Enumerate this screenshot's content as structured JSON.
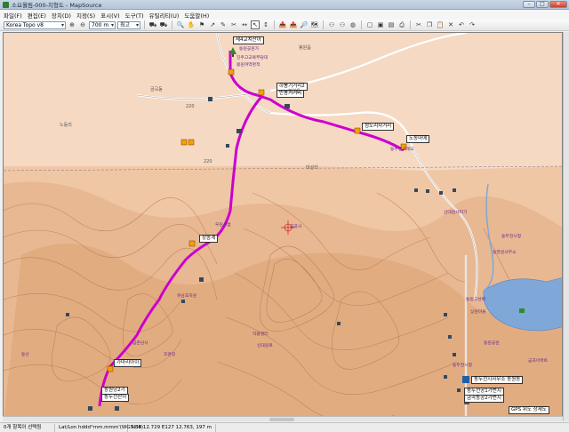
{
  "window": {
    "title": "소요월림-000-지형도 - MapSource",
    "buttons": {
      "minimize": "–",
      "maximize": "□",
      "close": "✕"
    }
  },
  "menu": [
    "파일(F)",
    "편집(E)",
    "장치(D)",
    "지정(S)",
    "표시(V)",
    "도구(T)",
    "유틸리티(U)",
    "도움말(H)"
  ],
  "toolbar": {
    "product": "Korea Topo v8",
    "zoom": "700 m",
    "detail": "최고"
  },
  "map": {
    "waypoints": [
      {
        "name": "제4교치산아"
      },
      {
        "name": "하봉기거리2"
      },
      {
        "name": "반봉기거리"
      },
      {
        "name": "청도리사거리"
      },
      {
        "name": "노동마에"
      },
      {
        "name": "상송계"
      },
      {
        "name": "가마리아이"
      },
      {
        "name": "동원당2가"
      },
      {
        "name": "동두천산아"
      },
      {
        "name": "동두천시청"
      },
      {
        "name": "동영원사무소"
      }
    ],
    "place_labels": [
      "봉원읍",
      "220",
      "220",
      "봉원읍",
      "노동리",
      "금곡동",
      "대성리"
    ],
    "pois": [
      "동원공원가",
      "진주고교북부당대",
      "봉원여역명적",
      "동두천교해모",
      "금곡사",
      "동두천시청",
      "동영원사무소",
      "동원고성벽",
      "상원마을",
      "유남초지원",
      "하봉명터",
      "신대원로",
      "동산",
      "산대원사터기",
      "우원시범",
      "금촌남사",
      "조명길",
      "동원공원",
      "동두천시청",
      "금곡아파트"
    ],
    "bottom_right": {
      "office": "동두천시사무소 동원동",
      "a": "동두천공1가번지",
      "b": "금곡동공2가번지",
      "gps": "GPS 위도 상세도"
    }
  },
  "status": {
    "tool": "0개 항목이 선택됨",
    "format": "Lat/Lon hddd°mm.mmm'(WGS 84)",
    "coords": "N38 12.729 E127 12.763, 197 m"
  },
  "colors": {
    "route": "#cc00cc",
    "lowland": "#f5d9c3",
    "contour": "#b8744a",
    "water": "#7fa7d8",
    "road": "#ffffff"
  }
}
